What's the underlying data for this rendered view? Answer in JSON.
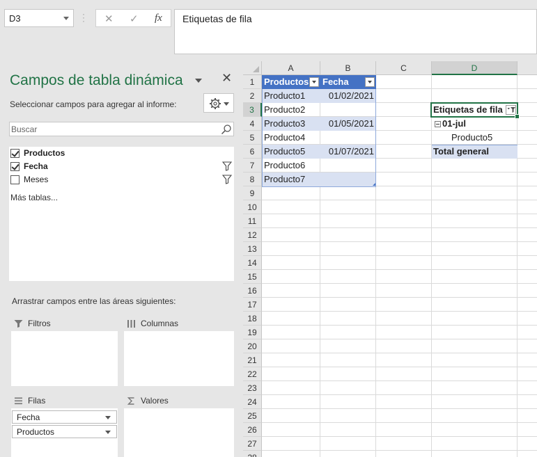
{
  "formula_bar": {
    "name_box": "D3",
    "cancel_glyph": "✕",
    "enter_glyph": "✓",
    "fx_glyph": "fx",
    "content": "Etiquetas de fila"
  },
  "pivot_pane": {
    "title": "Campos de tabla dinámica",
    "close_glyph": "✕",
    "subtitle": "Seleccionar campos para agregar al informe:",
    "search_placeholder": "Buscar",
    "fields": [
      {
        "label": "Productos",
        "checked": true,
        "bold": true,
        "has_filter": false
      },
      {
        "label": "Fecha",
        "checked": true,
        "bold": true,
        "has_filter": true
      },
      {
        "label": "Meses",
        "checked": false,
        "bold": false,
        "has_filter": true
      }
    ],
    "more_tables": "Más tablas...",
    "drag_label": "Arrastrar campos entre las áreas siguientes:",
    "areas": {
      "filters": "Filtros",
      "columns": "Columnas",
      "rows": "Filas",
      "values": "Valores"
    },
    "row_chips": [
      "Fecha",
      "Productos"
    ]
  },
  "sheet": {
    "columns": [
      "A",
      "B",
      "C",
      "D"
    ],
    "rows": [
      "1",
      "2",
      "3",
      "4",
      "5",
      "6",
      "7",
      "8",
      "9",
      "10",
      "11",
      "12",
      "13",
      "14",
      "15",
      "16",
      "17",
      "18",
      "19",
      "20",
      "21",
      "22",
      "23",
      "24",
      "25",
      "26",
      "27",
      "28"
    ],
    "table_headers": [
      "Productos",
      "Fecha"
    ],
    "table_rows": [
      [
        "Producto1",
        "01/02/2021"
      ],
      [
        "Producto2",
        ""
      ],
      [
        "Producto3",
        "01/05/2021"
      ],
      [
        "Producto4",
        ""
      ],
      [
        "Producto5",
        "01/07/2021"
      ],
      [
        "Producto6",
        ""
      ],
      [
        "Producto7",
        ""
      ]
    ],
    "pivot": {
      "header": "Etiquetas de fila",
      "group": "01-jul",
      "item": "Producto5",
      "total": "Total general"
    }
  },
  "colors": {
    "accent_green": "#217346",
    "table_header_blue": "#4472c4",
    "table_band": "#d9e1f2"
  }
}
